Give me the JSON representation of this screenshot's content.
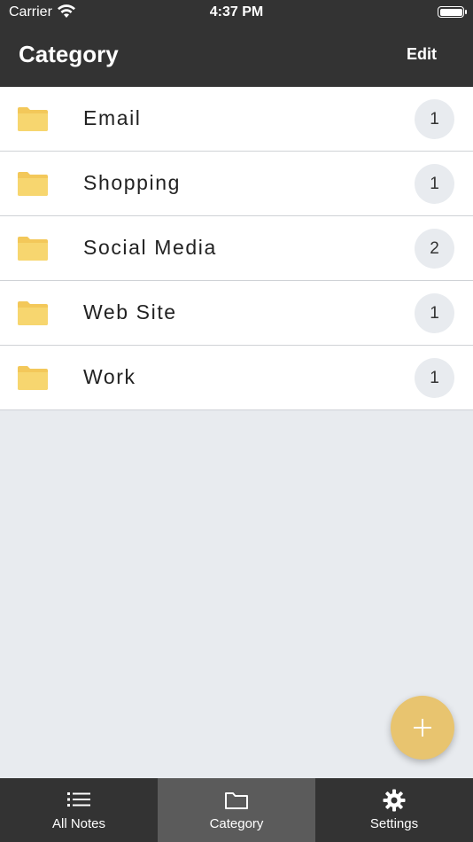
{
  "status_bar": {
    "carrier": "Carrier",
    "time": "4:37 PM"
  },
  "header": {
    "title": "Category",
    "edit_label": "Edit"
  },
  "categories": [
    {
      "label": "Email",
      "count": "1",
      "icon": "folder-icon"
    },
    {
      "label": "Shopping",
      "count": "1",
      "icon": "folder-icon"
    },
    {
      "label": "Social Media",
      "count": "2",
      "icon": "folder-icon"
    },
    {
      "label": "Web Site",
      "count": "1",
      "icon": "folder-icon"
    },
    {
      "label": "Work",
      "count": "1",
      "icon": "folder-icon"
    }
  ],
  "fab": {
    "icon": "plus-icon"
  },
  "tabbar": {
    "tabs": [
      {
        "label": "All Notes",
        "icon": "list-icon",
        "active": false
      },
      {
        "label": "Category",
        "icon": "folder-outline-icon",
        "active": true
      },
      {
        "label": "Settings",
        "icon": "gear-icon",
        "active": false
      }
    ]
  },
  "colors": {
    "header_bg": "#333333",
    "folder": "#f7d36a",
    "fab": "#e8c46f",
    "badge_bg": "#e8ebef",
    "page_bg": "#e8ebef",
    "active_tab": "#5b5b5b"
  }
}
